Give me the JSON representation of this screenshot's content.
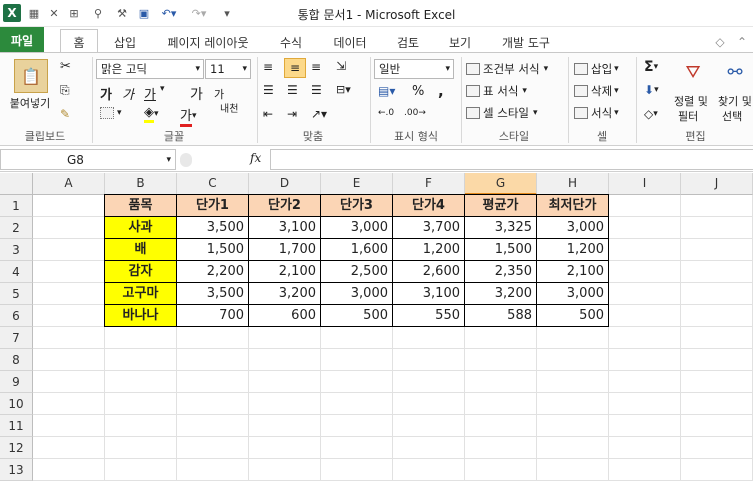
{
  "window": {
    "title": "통합 문서1 - Microsoft Excel"
  },
  "tabs": [
    "파일",
    "홈",
    "삽입",
    "페이지 레이아웃",
    "수식",
    "데이터",
    "검토",
    "보기",
    "개발 도구"
  ],
  "ribbon": {
    "clipboard": {
      "paste": "붙여넣기",
      "label": "클립보드"
    },
    "font": {
      "name": "맑은 고딕",
      "size": "11",
      "label": "글꼴",
      "bold": "가",
      "italic": "가",
      "underline": "가",
      "grow": "가",
      "shrink": "가",
      "phonetic": "내천",
      "fontcolor": "가"
    },
    "align": {
      "label": "맞춤"
    },
    "number": {
      "format": "일반",
      "percent": "%",
      "comma": ",",
      "label": "표시 형식"
    },
    "styles": {
      "conditional": "조건부 서식",
      "table": "표 서식",
      "cell": "셀 스타일",
      "label": "스타일"
    },
    "cells": {
      "insert": "삽입",
      "delete": "삭제",
      "format": "서식",
      "label": "셀"
    },
    "editing": {
      "sort": "정렬 및",
      "sort2": "필터",
      "find": "찾기 및",
      "find2": "선택",
      "label": "편집"
    }
  },
  "formula_bar": {
    "name_box": "G8",
    "fx": "fx",
    "value": ""
  },
  "columns": [
    "A",
    "B",
    "C",
    "D",
    "E",
    "F",
    "G",
    "H",
    "I",
    "J"
  ],
  "rows": [
    "1",
    "2",
    "3",
    "4",
    "5",
    "6",
    "7",
    "8",
    "9",
    "10",
    "11",
    "12",
    "13"
  ],
  "table": {
    "headers": [
      "품목",
      "단가1",
      "단가2",
      "단가3",
      "단가4",
      "평균가",
      "최저단가"
    ],
    "data": [
      [
        "사과",
        "3,500",
        "3,100",
        "3,000",
        "3,700",
        "3,325",
        "3,000"
      ],
      [
        "배",
        "1,500",
        "1,700",
        "1,600",
        "1,200",
        "1,500",
        "1,200"
      ],
      [
        "감자",
        "2,200",
        "2,100",
        "2,500",
        "2,600",
        "2,350",
        "2,100"
      ],
      [
        "고구마",
        "3,500",
        "3,200",
        "3,000",
        "3,100",
        "3,200",
        "3,000"
      ],
      [
        "바나나",
        "700",
        "600",
        "500",
        "550",
        "588",
        "500"
      ]
    ]
  }
}
